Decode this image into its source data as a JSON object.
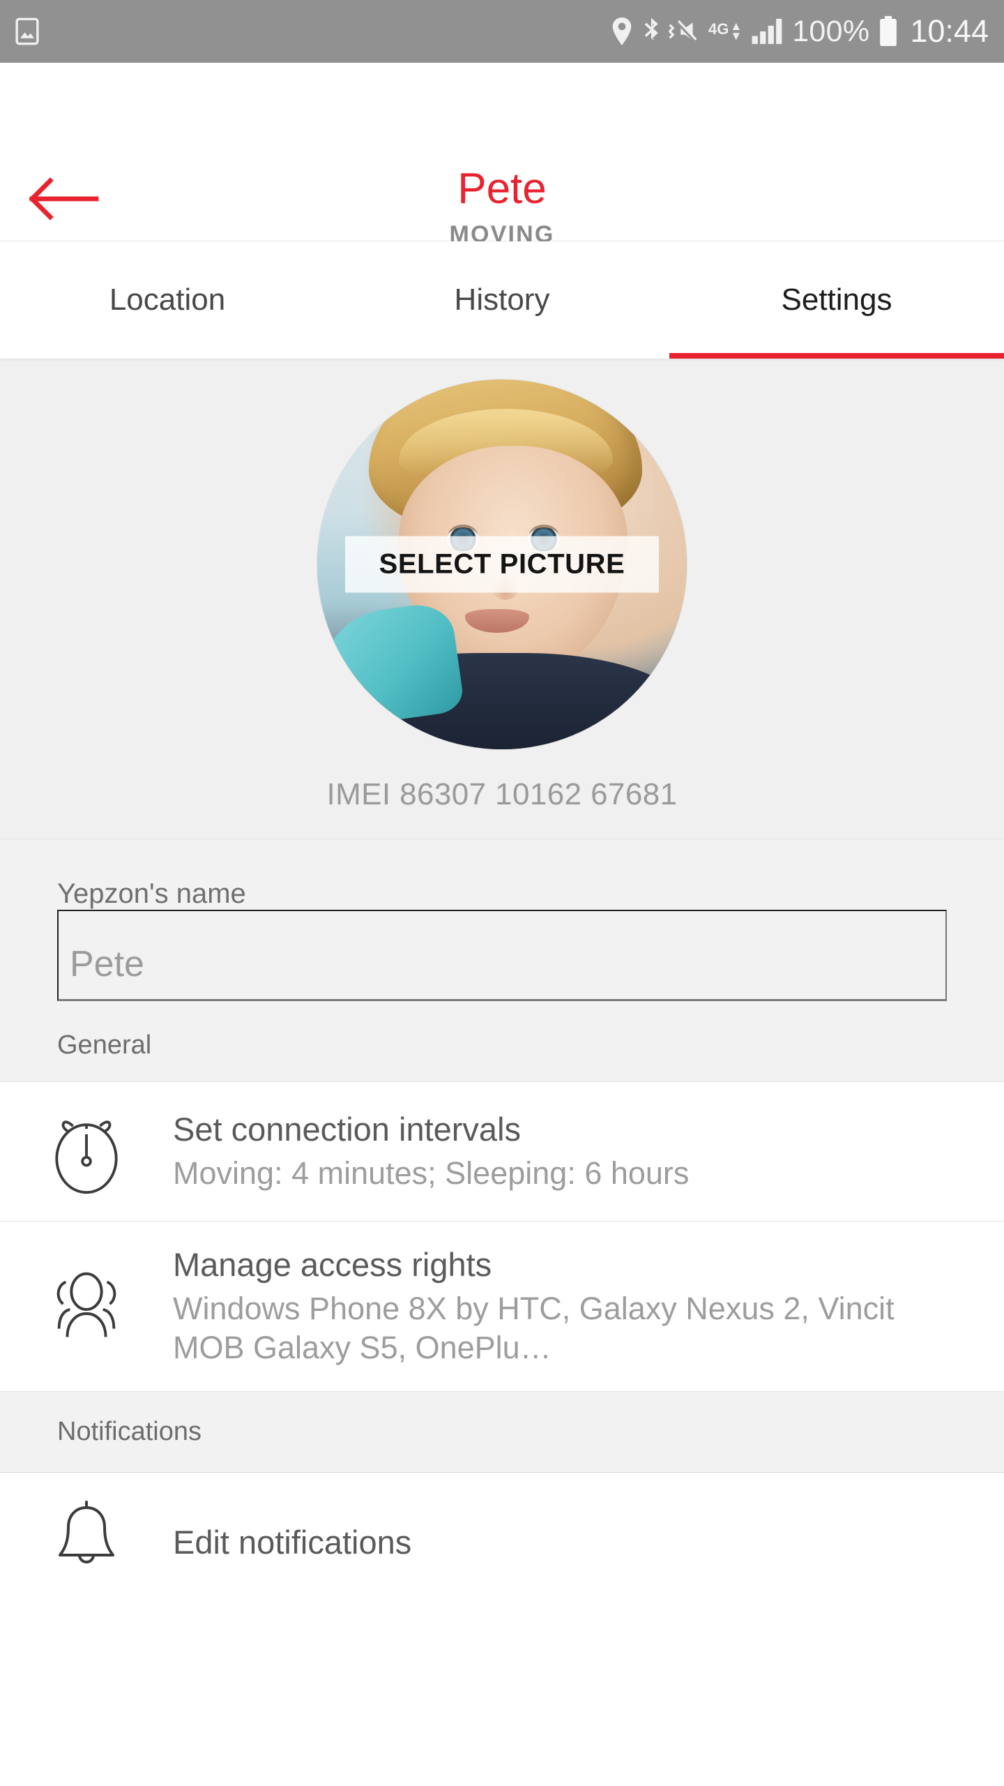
{
  "statusbar": {
    "icons_left": [
      "image-icon"
    ],
    "icons_right": [
      "location-pin-icon",
      "bluetooth-icon",
      "vibrate-mute-icon",
      "4g-icon",
      "signal-bars-icon"
    ],
    "network_label": "4G",
    "battery_percent": "100%",
    "time": "10:44"
  },
  "header": {
    "back_icon": "back-arrow-icon",
    "title": "Pete",
    "subtitle": "MOVING",
    "accent_color": "#e8222e"
  },
  "tabs": [
    {
      "label": "Location",
      "active": false
    },
    {
      "label": "History",
      "active": false
    },
    {
      "label": "Settings",
      "active": true
    }
  ],
  "avatar": {
    "overlay_label": "SELECT PICTURE",
    "imei": "IMEI 86307 10162 67681"
  },
  "form": {
    "name_label": "Yepzon's name",
    "name_value": "Pete",
    "name_placeholder": "Pete"
  },
  "sections": [
    {
      "title": "General",
      "rows": [
        {
          "icon": "stopwatch-icon",
          "title": "Set connection intervals",
          "subtitle": "Moving: 4 minutes; Sleeping: 6 hours"
        },
        {
          "icon": "people-group-icon",
          "title": "Manage access rights",
          "subtitle": "Windows Phone 8X by HTC, Galaxy Nexus 2, Vincit MOB Galaxy S5, OnePlu…"
        }
      ]
    },
    {
      "title": "Notifications",
      "rows": [
        {
          "icon": "bell-icon",
          "title": "Edit notifications",
          "subtitle": ""
        }
      ]
    }
  ]
}
